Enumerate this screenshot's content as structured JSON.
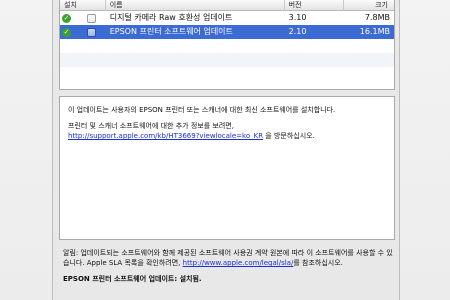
{
  "table": {
    "headers": {
      "install": "설치",
      "name": "이름",
      "version": "버전",
      "size": "크기"
    },
    "rows": [
      {
        "name": "디지털 카메라 Raw 호환성 업데이트",
        "version": "3.10",
        "size": "7.8MB",
        "installed": true,
        "selected": false
      },
      {
        "name": "EPSON 프린터 소프트웨어 업데이트",
        "version": "2.10",
        "size": "16.1MB",
        "installed": true,
        "selected": true
      }
    ]
  },
  "description": {
    "line1": "이 업데이트는 사용자의 EPSON 프린터 또는 스캐너에 대한 최신 소프트웨어를 설치합니다.",
    "line2": "프린터 및 스캐너 소프트웨어에 대한 추가 정보를 보려면,",
    "link": "http://support.apple.com/kb/HT3669?viewlocale=ko_KR",
    "after_link": " 을 방문하십시오."
  },
  "notes": {
    "text_before_link": "알림: 업데이트되는 소프트웨어와 함께 제공된 소프트웨어 사용권 계약 원본에 따라 이 소프트웨어를 사용할 수 있습니다. Apple SLA 목록을 확인하려면, ",
    "link": "http://www.apple.com/legal/sla/",
    "text_after_link": "를 참조하십시오.",
    "status": "EPSON 프린터 소프트웨어 업데이트: 설치됨."
  },
  "colors": {
    "selection": "#3d6bd4",
    "link": "#1b2fd6",
    "check": "#3aa12d"
  }
}
